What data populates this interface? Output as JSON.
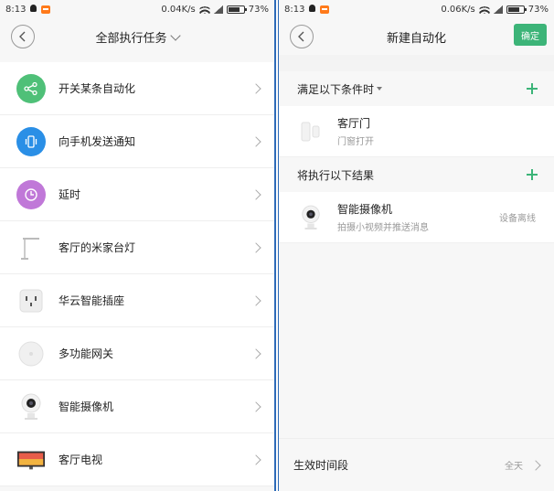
{
  "left": {
    "status": {
      "time": "8:13",
      "speed": "0.04K/s",
      "battery": "73%"
    },
    "header": {
      "title": "全部执行任务"
    },
    "items": [
      {
        "label": "开关某条自动化",
        "icon": "automation-switch-icon"
      },
      {
        "label": "向手机发送通知",
        "icon": "phone-notification-icon"
      },
      {
        "label": "延时",
        "icon": "delay-timer-icon"
      },
      {
        "label": "客厅的米家台灯",
        "icon": "desk-lamp-icon"
      },
      {
        "label": "华云智能插座",
        "icon": "smart-socket-icon"
      },
      {
        "label": "多功能网关",
        "icon": "gateway-icon"
      },
      {
        "label": "智能摄像机",
        "icon": "camera-icon"
      },
      {
        "label": "客厅电视",
        "icon": "tv-icon"
      }
    ]
  },
  "right": {
    "status": {
      "time": "8:13",
      "speed": "0.06K/s",
      "battery": "73%"
    },
    "header": {
      "title": "新建自动化",
      "confirm": "确定"
    },
    "conditions": {
      "title": "满足以下条件时",
      "items": [
        {
          "name": "客厅门",
          "sub": "门窗打开",
          "icon": "door-sensor-icon"
        }
      ]
    },
    "results": {
      "title": "将执行以下结果",
      "items": [
        {
          "name": "智能摄像机",
          "sub": "拍摄小视频并推送消息",
          "status": "设备离线",
          "icon": "camera-icon"
        }
      ]
    },
    "bottom": {
      "label": "生效时间段",
      "value": "全天"
    }
  },
  "colors": {
    "accent": "#3cb478",
    "divider": "#2e6bb8"
  }
}
